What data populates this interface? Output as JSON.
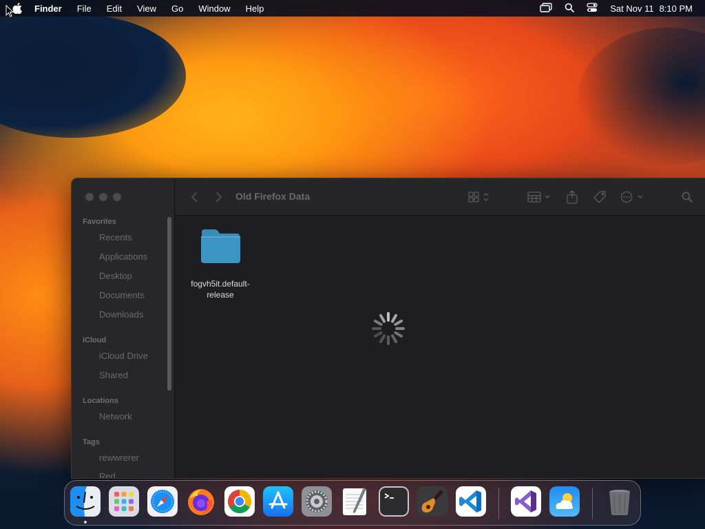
{
  "menubar": {
    "app_name": "Finder",
    "menus": [
      "File",
      "Edit",
      "View",
      "Go",
      "Window",
      "Help"
    ],
    "clock_date": "Sat Nov 11",
    "clock_time": "8:10 PM"
  },
  "window": {
    "title": "Old Firefox Data",
    "sidebar": {
      "favorites_header": "Favorites",
      "favorites": [
        "Recents",
        "Applications",
        "Desktop",
        "Documents",
        "Downloads"
      ],
      "icloud_header": "iCloud",
      "icloud": [
        "iCloud Drive",
        "Shared"
      ],
      "locations_header": "Locations",
      "locations": [
        "Network"
      ],
      "tags_header": "Tags",
      "tags": [
        "rewwrerer",
        "Red"
      ]
    },
    "items": [
      {
        "name_line1": "fogvh5it.default-",
        "name_line2": "release",
        "icon": "folder-icon"
      }
    ],
    "loading": true
  },
  "dock": {
    "apps": [
      "Finder",
      "Launchpad",
      "Safari",
      "Firefox",
      "Google Chrome",
      "App Store",
      "System Settings",
      "TextEdit",
      "Terminal",
      "GarageBand",
      "Visual Studio Code",
      "Visual Studio",
      "Weather",
      "Trash"
    ]
  },
  "colors": {
    "menubar_bg": "#0c101c",
    "window_bg": "#1e1e20",
    "sidebar_text": "#6b6b6f",
    "folder_blue": "#3c95c2"
  }
}
